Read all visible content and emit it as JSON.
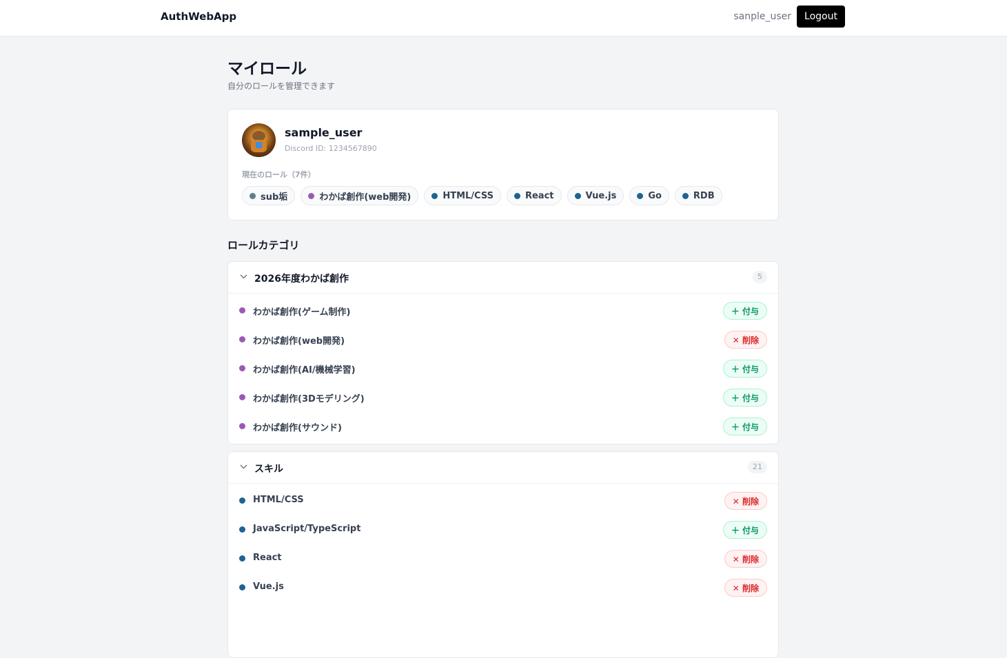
{
  "header": {
    "brand": "AuthWebApp",
    "username": "sanple_user",
    "logout_label": "Logout"
  },
  "page": {
    "title": "マイロール",
    "subtitle": "自分のロールを管理できます"
  },
  "profile": {
    "name": "sample_user",
    "discord_id": "Discord ID: 1234567890",
    "roles_label": "現在のロール（7件）",
    "roles": [
      {
        "label": "sub垢",
        "color": "#607d8b"
      },
      {
        "label": "わかば創作(web開発)",
        "color": "#9b59b6"
      },
      {
        "label": "HTML/CSS",
        "color": "#1f6391"
      },
      {
        "label": "React",
        "color": "#1f6391"
      },
      {
        "label": "Vue.js",
        "color": "#1f6391"
      },
      {
        "label": "Go",
        "color": "#1f6391"
      },
      {
        "label": "RDB",
        "color": "#1f6391"
      }
    ]
  },
  "categories_title": "ロールカテゴリ",
  "categories": [
    {
      "name": "2026年度わかば創作",
      "count": "5",
      "color": "#9b59b6",
      "roles": [
        {
          "name": "わかば創作(ゲーム制作)",
          "action": "＋ 付与"
        },
        {
          "name": "わかば創作(web開発)",
          "action": "✕ 削除"
        },
        {
          "name": "わかば創作(AI/機械学習)",
          "action": "＋ 付与"
        },
        {
          "name": "わかば創作(3Dモデリング)",
          "action": "＋ 付与"
        },
        {
          "name": "わかば創作(サウンド)",
          "action": "＋ 付与"
        }
      ]
    },
    {
      "name": "スキル",
      "count": "21",
      "color": "#1f6391",
      "roles": [
        {
          "name": "HTML/CSS",
          "action": "✕ 削除"
        },
        {
          "name": "JavaScript/TypeScript",
          "action": "＋ 付与"
        },
        {
          "name": "React",
          "action": "✕ 削除"
        },
        {
          "name": "Vue.js",
          "action": "✕ 削除"
        }
      ]
    }
  ],
  "icons": {
    "chevron": "chevron-down-icon",
    "avatar": "avatar-image"
  }
}
